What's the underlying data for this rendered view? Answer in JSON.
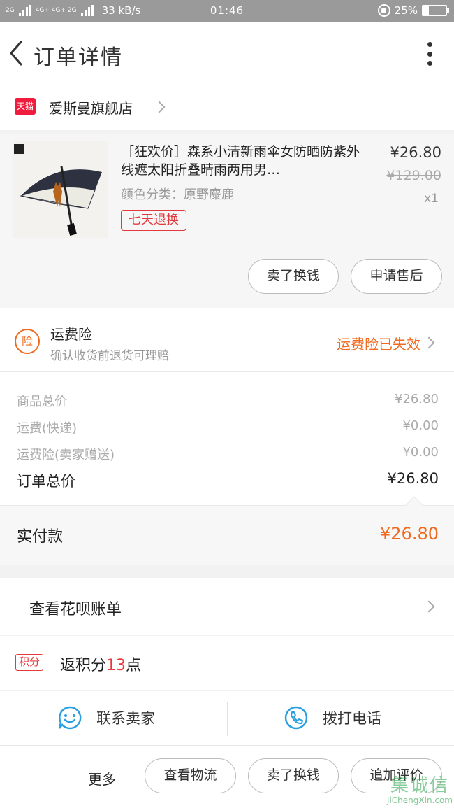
{
  "status_bar": {
    "network_left": "2G",
    "network_mid": "4G+ 4G+ 2G",
    "speed": "33 kB/s",
    "time": "01:46",
    "battery_percent": "25%",
    "battery_level": 0.25
  },
  "header": {
    "title": "订单详情",
    "back_icon": "chevron-left-icon",
    "more_icon": "vertical-dots-icon"
  },
  "shop": {
    "badge": "天猫",
    "name": "爱斯曼旗舰店"
  },
  "product": {
    "title": "［狂欢价］森系小清新雨伞女防晒防紫外线遮太阳折叠晴雨两用男…",
    "variant": "颜色分类：原野麋鹿",
    "tag": "七天退换",
    "price": "¥26.80",
    "original_price": "¥129.00",
    "quantity": "x1",
    "actions": [
      "卖了换钱",
      "申请售后"
    ]
  },
  "insurance": {
    "icon_text": "险",
    "title": "运费险",
    "subtitle": "确认收货前退货可理赔",
    "status": "运费险已失效"
  },
  "price_summary": {
    "rows": [
      {
        "label": "商品总价",
        "value": "¥26.80"
      },
      {
        "label": "运费(快递)",
        "value": "¥0.00"
      },
      {
        "label": "运费险(卖家赠送)",
        "value": "¥0.00"
      }
    ],
    "total_label": "订单总价",
    "total_value": "¥26.80"
  },
  "payable": {
    "label": "实付款",
    "value": "¥26.80"
  },
  "huabei": {
    "label": "查看花呗账单"
  },
  "points": {
    "badge": "积分",
    "prefix": "返积分",
    "number": "13",
    "suffix": "点"
  },
  "contact": {
    "seller_label": "联系卖家",
    "phone_label": "拨打电话"
  },
  "footer": {
    "more_label": "更多",
    "buttons": [
      "查看物流",
      "卖了换钱",
      "追加评价"
    ]
  },
  "watermark": {
    "text": "集诚信",
    "url": "JiChengXin.com"
  },
  "colors": {
    "accent_orange": "#ef6a1f",
    "accent_red": "#e4393c",
    "tmall_red": "#ef1c3d",
    "status_bar_gray": "#9a9a9a"
  }
}
